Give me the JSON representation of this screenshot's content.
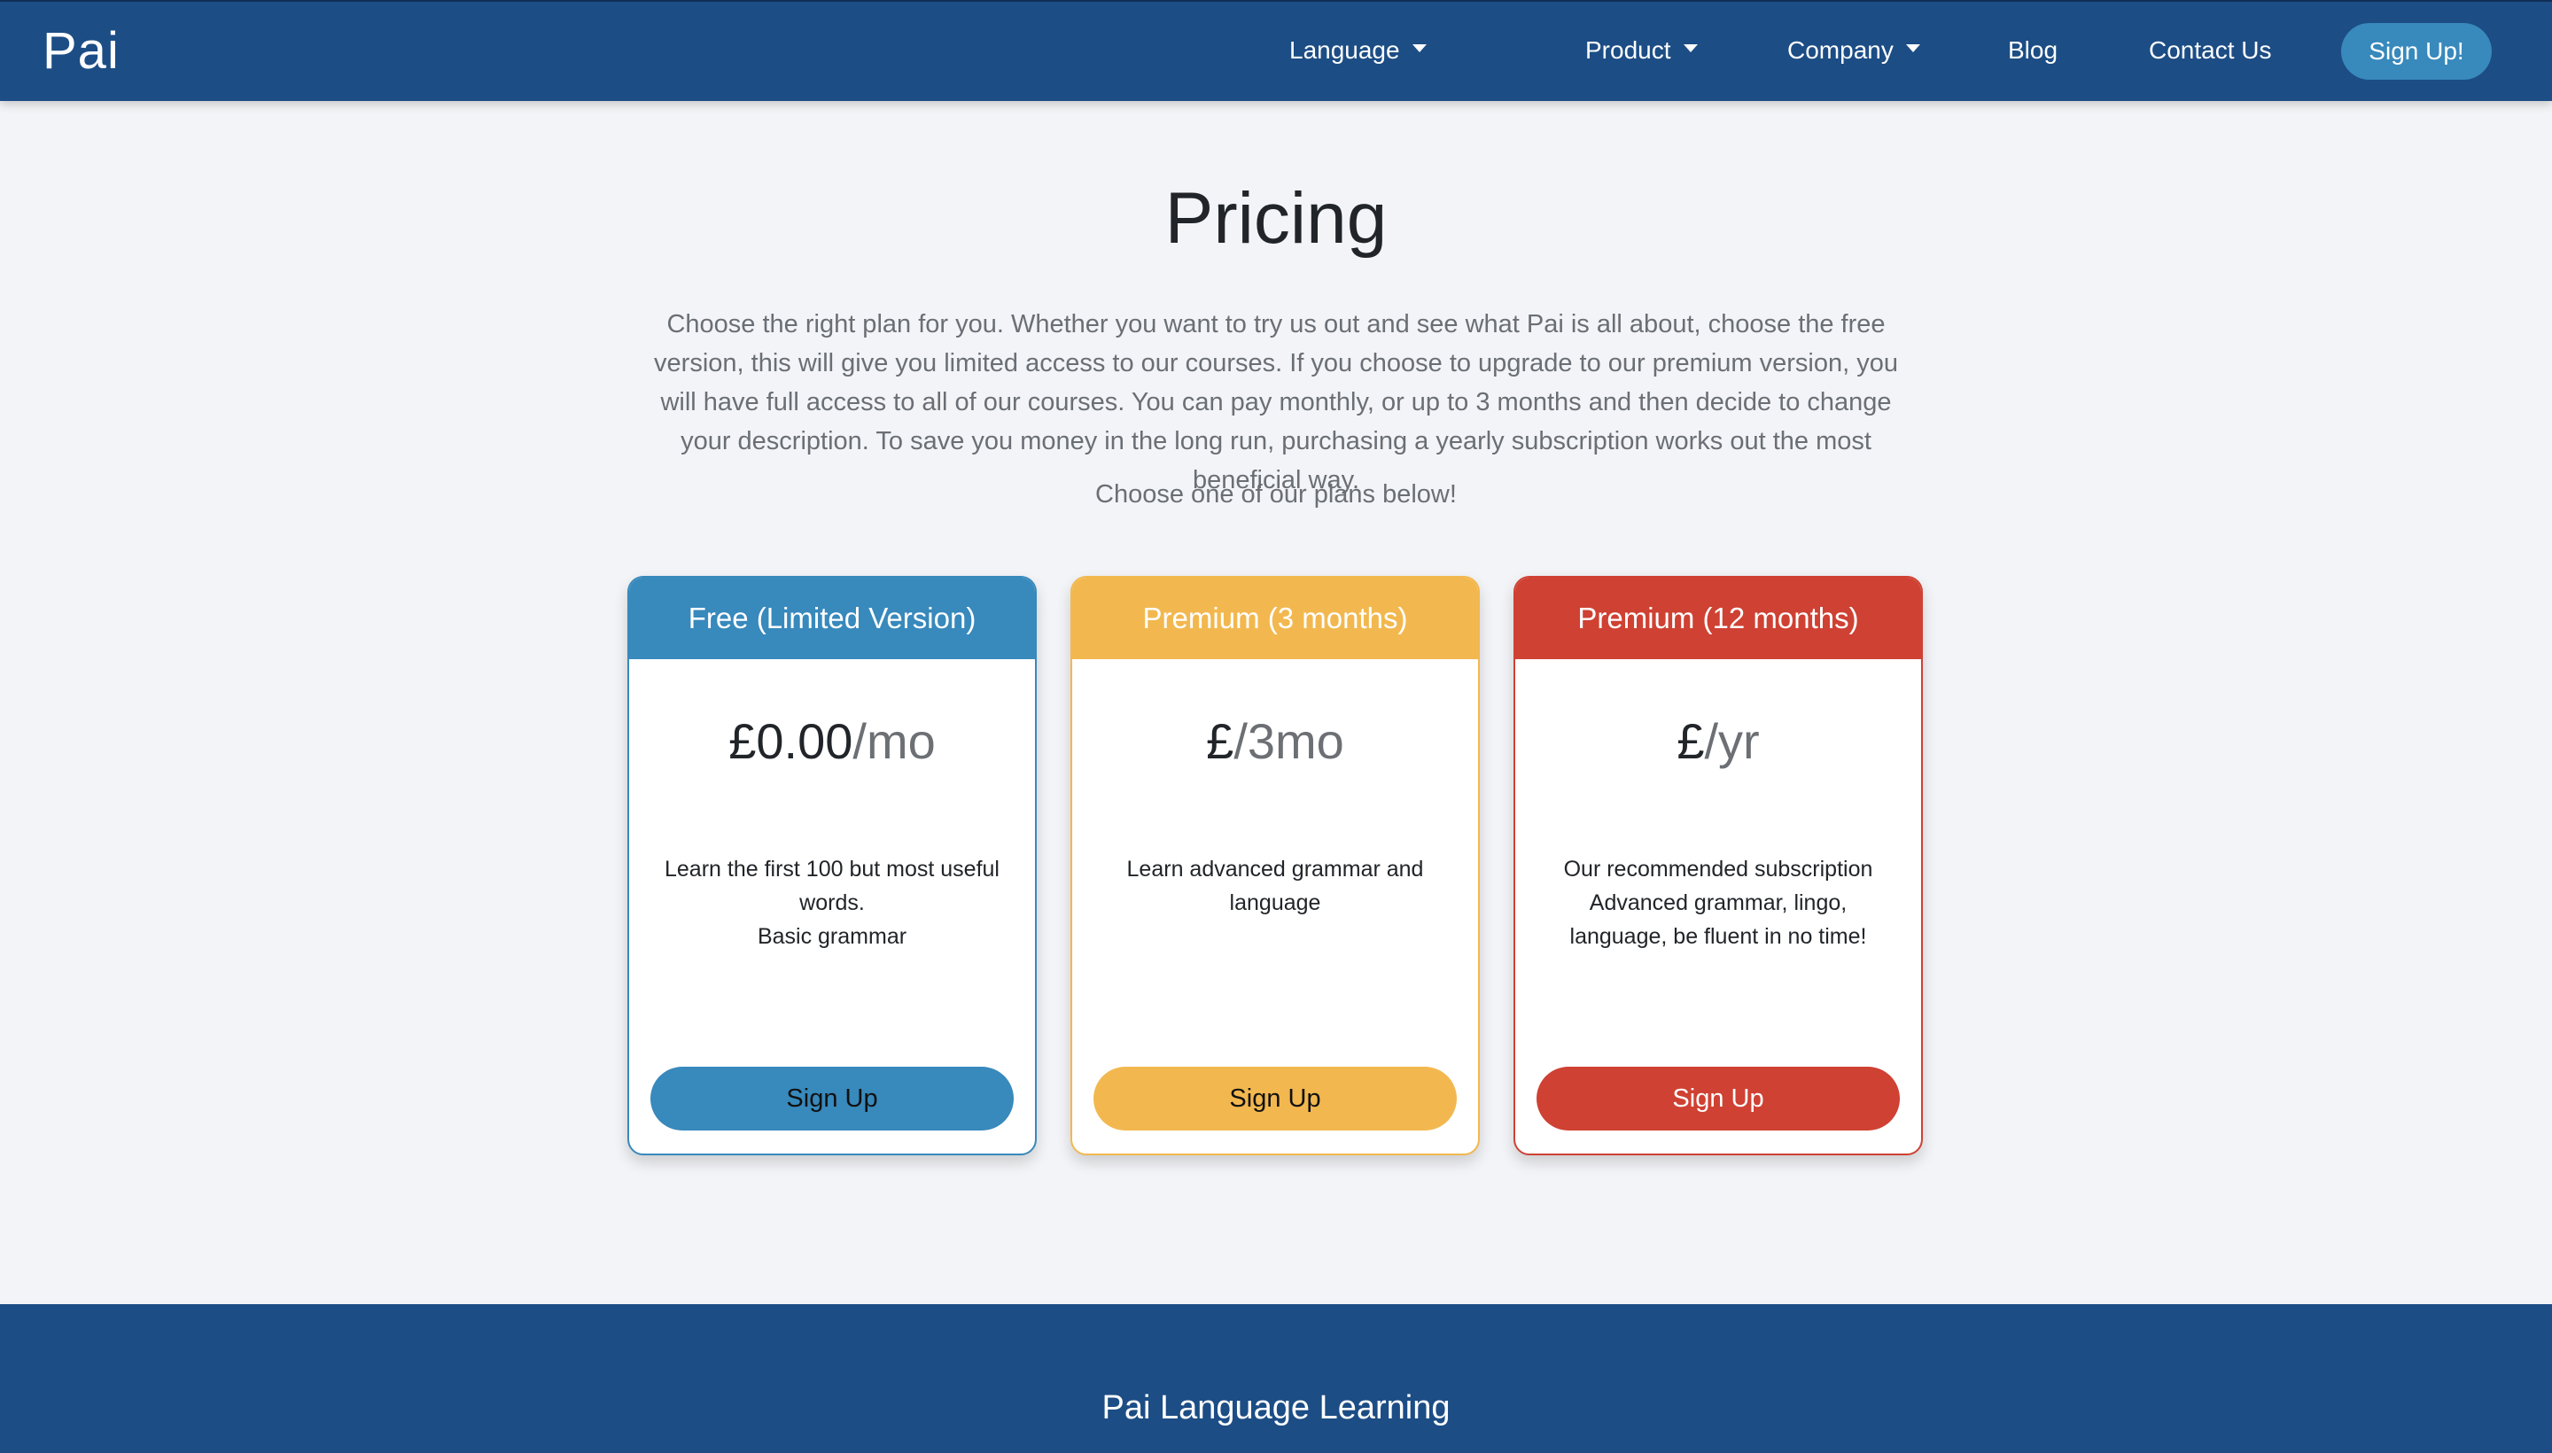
{
  "nav": {
    "logo": "Pai",
    "language": "Language",
    "product": "Product",
    "company": "Company",
    "blog": "Blog",
    "contact": "Contact Us",
    "signup": "Sign Up!"
  },
  "main": {
    "title": "Pricing",
    "intro": "Choose the right plan for you. Whether you want to try us out and see what Pai is all about, choose the free version, this will give you limited access to our courses. If you choose to upgrade to our premium version, you will have full access to all of our courses. You can pay monthly, or up to 3 months and then decide to change your description. To save you money in the long run, purchasing a yearly subscription works out the most beneficial way.",
    "choose": "Choose one of our plans below!"
  },
  "plans": [
    {
      "title": "Free (Limited Version)",
      "amount": "£0.00",
      "period": "/mo",
      "lines": [
        "Learn the first 100 but most useful words.",
        "Basic grammar"
      ],
      "button": "Sign Up",
      "color": "#3889bc",
      "button_text_color": "#111111"
    },
    {
      "title": "Premium (3 months)",
      "amount": "£",
      "period": "/3mo",
      "lines": [
        "Learn advanced grammar and language"
      ],
      "button": "Sign Up",
      "color": "#f2b84f",
      "button_text_color": "#111111"
    },
    {
      "title": "Premium (12 months)",
      "amount": "£",
      "period": "/yr",
      "lines": [
        "Our recommended subscription",
        "Advanced grammar, lingo, language, be fluent in no time!"
      ],
      "button": "Sign Up",
      "color": "#cf4133",
      "button_text_color": "#ffffff"
    }
  ],
  "footer": {
    "title": "Pai Language Learning"
  }
}
